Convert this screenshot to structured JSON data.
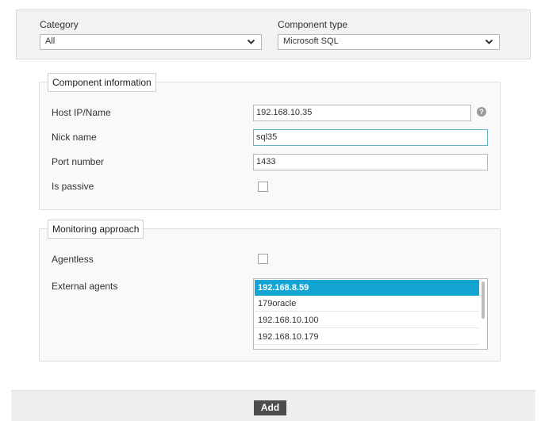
{
  "selectors": {
    "category": {
      "label": "Category",
      "value": "All"
    },
    "component_type": {
      "label": "Component type",
      "value": "Microsoft SQL"
    }
  },
  "component_info": {
    "legend": "Component information",
    "host": {
      "label": "Host IP/Name",
      "value": "192.168.10.35"
    },
    "help": "?",
    "nick": {
      "label": "Nick name",
      "value": "sql35"
    },
    "port": {
      "label": "Port number",
      "value": "1433"
    },
    "passive": {
      "label": "Is passive",
      "checked": false
    }
  },
  "monitoring": {
    "legend": "Monitoring approach",
    "agentless": {
      "label": "Agentless",
      "checked": false
    },
    "external_agents": {
      "label": "External agents",
      "items": [
        "192.168.8.59",
        "179oracle",
        "192.168.10.100",
        "192.168.10.179"
      ],
      "selected_index": 0
    }
  },
  "actions": {
    "add_label": "Add"
  },
  "colors": {
    "selection": "#13a5d1",
    "button": "#4d4d4d",
    "focus_border": "#62b7c7"
  }
}
